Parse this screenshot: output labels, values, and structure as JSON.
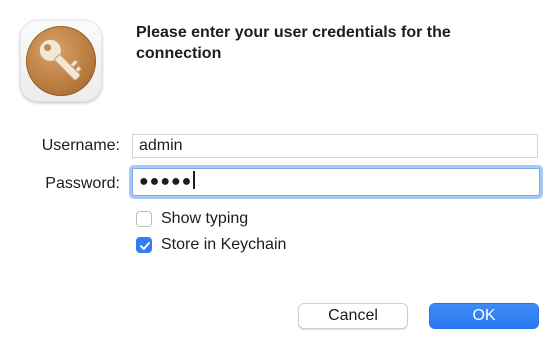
{
  "app_icon": {
    "name": "key-icon"
  },
  "heading": "Please enter your user credentials for the connection",
  "form": {
    "username_label": "Username:",
    "username_value": "admin",
    "password_label": "Password:",
    "password_value": "●●●●●",
    "password_length": 5
  },
  "options": {
    "show_typing_label": "Show typing",
    "show_typing_checked": false,
    "store_keychain_label": "Store in Keychain",
    "store_keychain_checked": true
  },
  "buttons": {
    "cancel_label": "Cancel",
    "ok_label": "OK"
  },
  "colors": {
    "accent": "#2F7CF6",
    "focus_ring": "#A9C8F2",
    "icon_brown": "#B97A3E"
  }
}
